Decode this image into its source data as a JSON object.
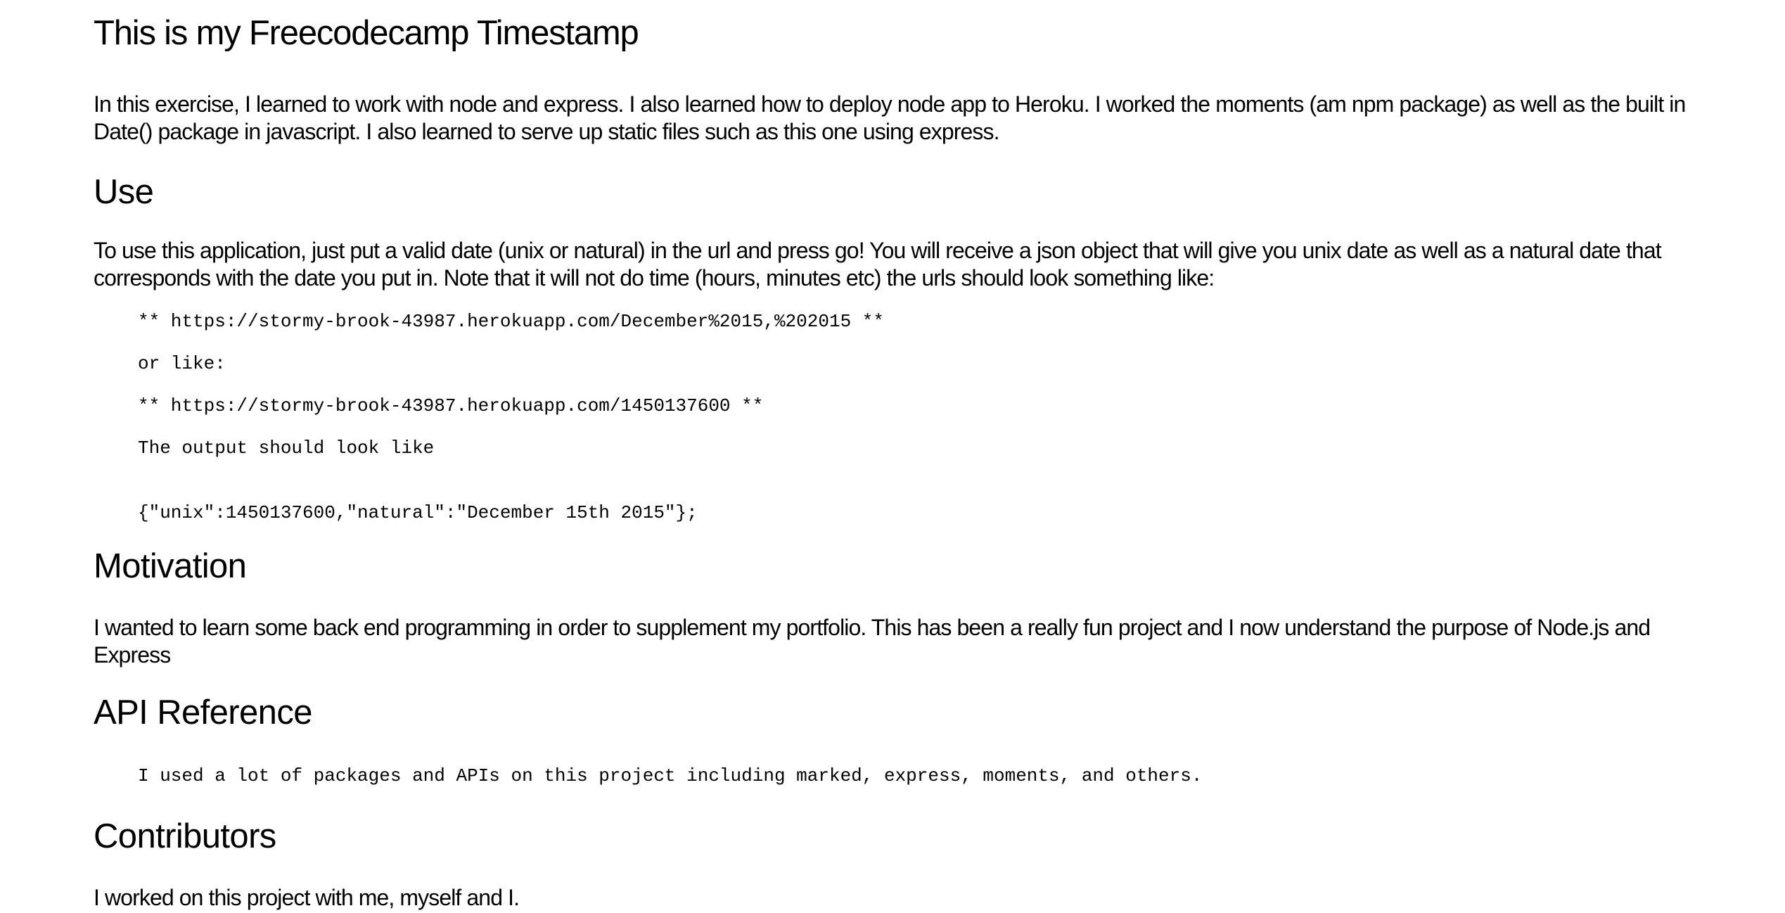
{
  "title": "This is my Freecodecamp Timestamp",
  "intro": "In this exercise, I learned to work with node and express. I also learned how to deploy node app to Heroku. I worked the moments (am npm package) as well as the built in Date() package in javascript. I also learned to serve up static files such as this one using express.",
  "use": {
    "heading": "Use",
    "paragraph": "To use this application, just put a valid date (unix or natural) in the url and press go! You will receive a json object that will give you unix date as well as a natural date that corresponds with the date you put in. Note that it will not do time (hours, minutes etc) the urls should look something like:",
    "code_lines": [
      "** https://stormy-brook-43987.herokuapp.com/December%2015,%202015 **",
      "or like:",
      "** https://stormy-brook-43987.herokuapp.com/1450137600 **",
      "The output should look like",
      "{\"unix\":1450137600,\"natural\":\"December 15th 2015\"};"
    ]
  },
  "motivation": {
    "heading": "Motivation",
    "paragraph": "I wanted to learn some back end programming in order to supplement my portfolio. This has been a really fun project and I now understand the purpose of Node.js and Express"
  },
  "api_reference": {
    "heading": "API Reference",
    "code": "I used a lot of packages and APIs on this project including marked, express, moments, and others."
  },
  "contributors": {
    "heading": "Contributors",
    "paragraph": "I worked on this project with me, myself and I."
  }
}
